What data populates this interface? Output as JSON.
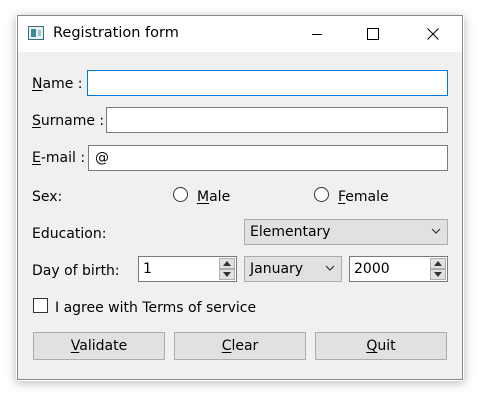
{
  "window": {
    "title": "Registration form",
    "controls": [
      "minimize-icon",
      "maximize-icon",
      "close-icon"
    ]
  },
  "form": {
    "name": {
      "label": "Name :",
      "mnemonic": "N",
      "value": ""
    },
    "surname": {
      "label": "Surname :",
      "mnemonic": "S",
      "value": ""
    },
    "email": {
      "label": "E-mail :",
      "mnemonic": "E",
      "value": "@"
    },
    "sex": {
      "label": "Sex:",
      "options": [
        {
          "label": "Male",
          "mnemonic": "M",
          "selected": false
        },
        {
          "label": "Female",
          "mnemonic": "F",
          "selected": false
        }
      ]
    },
    "education": {
      "label": "Education:",
      "selected": "Elementary"
    },
    "birth": {
      "label": "Day of birth:",
      "day": "1",
      "month": "January",
      "year": "2000"
    },
    "terms": {
      "label": "I agree with Terms of service",
      "checked": false
    }
  },
  "buttons": {
    "validate": {
      "label": "Validate",
      "mnemonic": "V"
    },
    "clear": {
      "label": "Clear",
      "mnemonic": "C"
    },
    "quit": {
      "label": "Quit",
      "mnemonic": "Q"
    }
  },
  "colors": {
    "focus_border": "#0078d7",
    "window_bg": "#f0f0f0",
    "button_bg": "#e1e1e1"
  }
}
